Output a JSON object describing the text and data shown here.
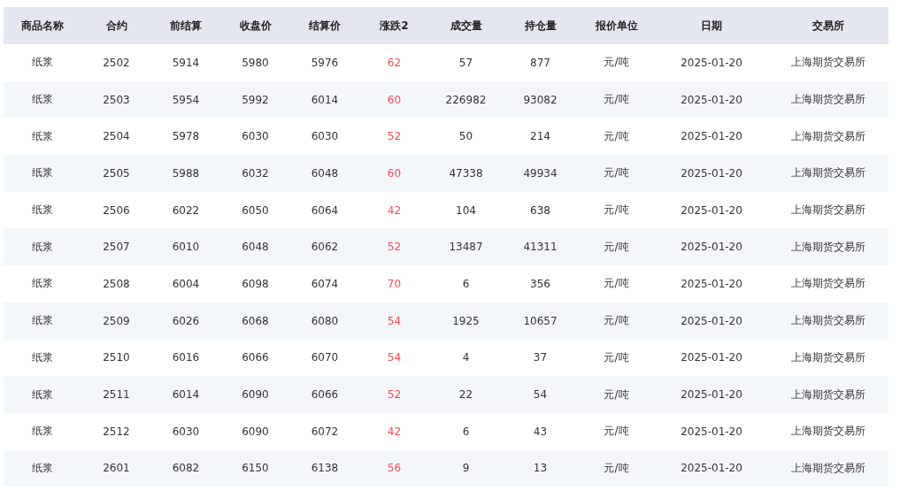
{
  "table": {
    "columns": [
      "商品名称",
      "合约",
      "前结算",
      "收盘价",
      "结算价",
      "涨跌2",
      "成交量",
      "持仓量",
      "报价单位",
      "日期",
      "交易所"
    ],
    "rows": [
      [
        "纸浆",
        "2502",
        "5914",
        "5980",
        "5976",
        "62",
        "57",
        "877",
        "元/吨",
        "2025-01-20",
        "上海期货交易所"
      ],
      [
        "纸浆",
        "2503",
        "5954",
        "5992",
        "6014",
        "60",
        "226982",
        "93082",
        "元/吨",
        "2025-01-20",
        "上海期货交易所"
      ],
      [
        "纸浆",
        "2504",
        "5978",
        "6030",
        "6030",
        "52",
        "50",
        "214",
        "元/吨",
        "2025-01-20",
        "上海期货交易所"
      ],
      [
        "纸浆",
        "2505",
        "5988",
        "6032",
        "6048",
        "60",
        "47338",
        "49934",
        "元/吨",
        "2025-01-20",
        "上海期货交易所"
      ],
      [
        "纸浆",
        "2506",
        "6022",
        "6050",
        "6064",
        "42",
        "104",
        "638",
        "元/吨",
        "2025-01-20",
        "上海期货交易所"
      ],
      [
        "纸浆",
        "2507",
        "6010",
        "6048",
        "6062",
        "52",
        "13487",
        "41311",
        "元/吨",
        "2025-01-20",
        "上海期货交易所"
      ],
      [
        "纸浆",
        "2508",
        "6004",
        "6098",
        "6074",
        "70",
        "6",
        "356",
        "元/吨",
        "2025-01-20",
        "上海期货交易所"
      ],
      [
        "纸浆",
        "2509",
        "6026",
        "6068",
        "6080",
        "54",
        "1925",
        "10657",
        "元/吨",
        "2025-01-20",
        "上海期货交易所"
      ],
      [
        "纸浆",
        "2510",
        "6016",
        "6066",
        "6070",
        "54",
        "4",
        "37",
        "元/吨",
        "2025-01-20",
        "上海期货交易所"
      ],
      [
        "纸浆",
        "2511",
        "6014",
        "6090",
        "6066",
        "52",
        "22",
        "54",
        "元/吨",
        "2025-01-20",
        "上海期货交易所"
      ],
      [
        "纸浆",
        "2512",
        "6030",
        "6090",
        "6072",
        "42",
        "6",
        "43",
        "元/吨",
        "2025-01-20",
        "上海期货交易所"
      ],
      [
        "纸浆",
        "2601",
        "6082",
        "6150",
        "6138",
        "56",
        "9",
        "13",
        "元/吨",
        "2025-01-20",
        "上海期货交易所"
      ]
    ]
  }
}
